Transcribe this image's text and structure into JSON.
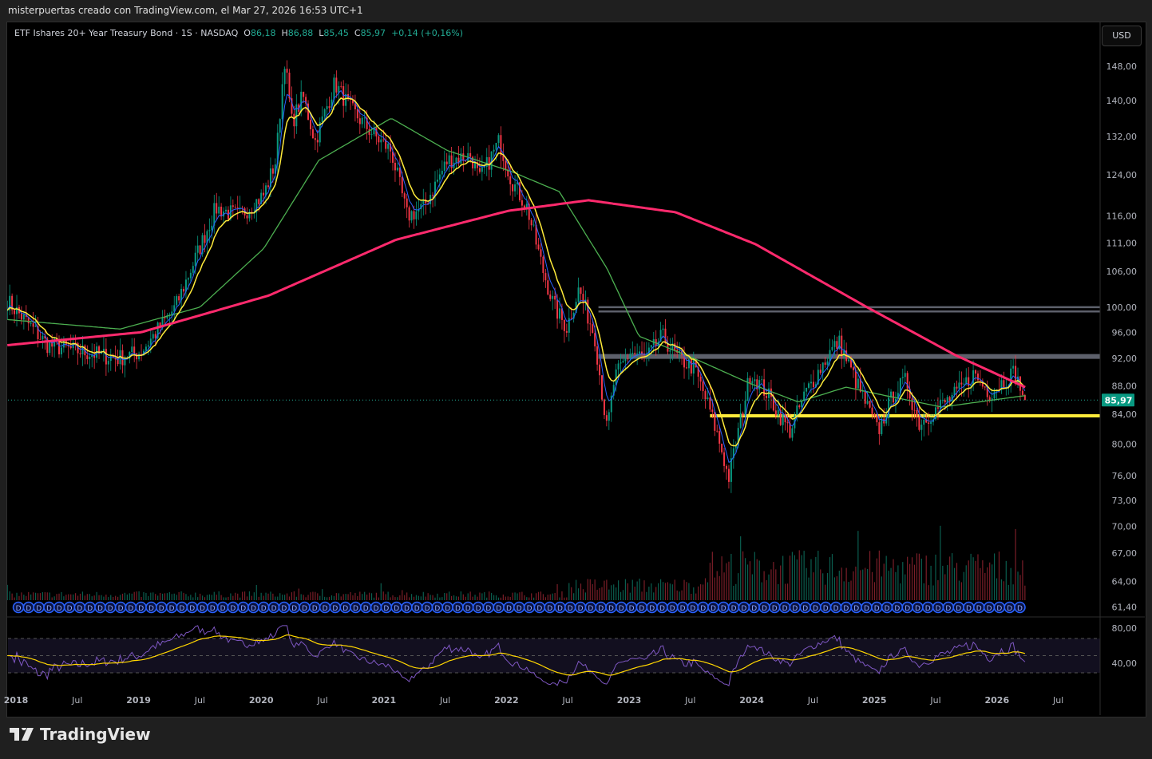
{
  "header": {
    "attribution": "misterpuertas creado con TradingView.com, el Mar 27, 2026 16:53 UTC+1"
  },
  "legend": {
    "symbol": "ETF Ishares 20+ Year Treasury Bond · 1S · NASDAQ",
    "o_label": "O",
    "o": "86,18",
    "h_label": "H",
    "h": "86,88",
    "l_label": "L",
    "l": "85,45",
    "c_label": "C",
    "c": "85,97",
    "change": "+0,14 (+0,16%)"
  },
  "currency_button": "USD",
  "brand": "TradingView",
  "colors": {
    "up": "#089981",
    "down": "#f23645",
    "ma200": "#ff2a6d",
    "ma50": "#4caf50",
    "ema_fast": "#ffeb3b",
    "ema_faster": "#2962ff",
    "rsi": "#7e57c2",
    "rsi_ma": "#ffd600",
    "level": "#5d606b",
    "support": "#ffeb3b"
  },
  "chart_data": {
    "type": "candlestick",
    "title": "ETF Ishares 20+ Year Treasury Bond · 1S · NASDAQ",
    "scale": "log",
    "ylim": [
      61.4,
      152
    ],
    "xlim": [
      2017.93,
      2026.6
    ],
    "y_ticks": [
      "148,00",
      "140,00",
      "132,00",
      "124,00",
      "116,00",
      "111,00",
      "106,00",
      "100,00",
      "96,00",
      "92,00",
      "88,00",
      "84,00",
      "80,00",
      "76,00",
      "73,00",
      "70,00",
      "67,00",
      "64,00",
      "61,40"
    ],
    "y_tick_values": [
      148,
      140,
      132,
      124,
      116,
      111,
      106,
      100,
      96,
      92,
      88,
      84,
      80,
      76,
      73,
      70,
      67,
      64,
      61.4
    ],
    "last_price": {
      "label": "85,97",
      "value": 85.97
    },
    "x_ticks": [
      {
        "t": 2018,
        "label": "2018"
      },
      {
        "t": 2018.5,
        "label": "Jul"
      },
      {
        "t": 2019,
        "label": "2019"
      },
      {
        "t": 2019.5,
        "label": "Jul"
      },
      {
        "t": 2020,
        "label": "2020"
      },
      {
        "t": 2020.5,
        "label": "Jul"
      },
      {
        "t": 2021,
        "label": "2021"
      },
      {
        "t": 2021.5,
        "label": "Jul"
      },
      {
        "t": 2022,
        "label": "2022"
      },
      {
        "t": 2022.5,
        "label": "Jul"
      },
      {
        "t": 2023,
        "label": "2023"
      },
      {
        "t": 2023.5,
        "label": "Jul"
      },
      {
        "t": 2024,
        "label": "2024"
      },
      {
        "t": 2024.5,
        "label": "Jul"
      },
      {
        "t": 2025,
        "label": "2025"
      },
      {
        "t": 2025.5,
        "label": "Jul"
      },
      {
        "t": 2026,
        "label": "2026"
      },
      {
        "t": 2026.5,
        "label": "Jul"
      }
    ],
    "price_path": [
      [
        2017.93,
        101
      ],
      [
        2018.26,
        94
      ],
      [
        2018.83,
        92
      ],
      [
        2019.02,
        93
      ],
      [
        2019.3,
        100
      ],
      [
        2019.63,
        117.5
      ],
      [
        2019.82,
        116
      ],
      [
        2020.02,
        120
      ],
      [
        2020.12,
        127
      ],
      [
        2020.19,
        150
      ],
      [
        2020.25,
        135
      ],
      [
        2020.34,
        141
      ],
      [
        2020.44,
        131
      ],
      [
        2020.6,
        144
      ],
      [
        2020.73,
        138
      ],
      [
        2020.93,
        132
      ],
      [
        2021.06,
        129
      ],
      [
        2021.19,
        116
      ],
      [
        2021.32,
        117.5
      ],
      [
        2021.52,
        127
      ],
      [
        2021.71,
        128
      ],
      [
        2021.78,
        123
      ],
      [
        2021.94,
        131
      ],
      [
        2022.04,
        123
      ],
      [
        2022.17,
        117.5
      ],
      [
        2022.3,
        106
      ],
      [
        2022.39,
        100
      ],
      [
        2022.49,
        96.7
      ],
      [
        2022.59,
        103
      ],
      [
        2022.72,
        95.4
      ],
      [
        2022.82,
        81.7
      ],
      [
        2022.88,
        89
      ],
      [
        2023.01,
        93
      ],
      [
        2023.14,
        92
      ],
      [
        2023.27,
        95.4
      ],
      [
        2023.4,
        92
      ],
      [
        2023.53,
        90.6
      ],
      [
        2023.66,
        84.5
      ],
      [
        2023.76,
        79
      ],
      [
        2023.81,
        75.6
      ],
      [
        2023.89,
        81.7
      ],
      [
        2023.99,
        90
      ],
      [
        2024.12,
        87
      ],
      [
        2024.31,
        81.7
      ],
      [
        2024.44,
        87
      ],
      [
        2024.64,
        93
      ],
      [
        2024.71,
        94.5
      ],
      [
        2024.84,
        89
      ],
      [
        2025.03,
        81.7
      ],
      [
        2025.16,
        87
      ],
      [
        2025.26,
        88.8
      ],
      [
        2025.36,
        82.7
      ],
      [
        2025.49,
        84.5
      ],
      [
        2025.68,
        87
      ],
      [
        2025.81,
        89.7
      ],
      [
        2025.94,
        87
      ],
      [
        2026.14,
        90
      ],
      [
        2026.23,
        86
      ]
    ],
    "ma200_path": [
      [
        2017.93,
        94
      ],
      [
        2019.02,
        96
      ],
      [
        2020.06,
        101.9
      ],
      [
        2021.1,
        111.6
      ],
      [
        2022.02,
        117
      ],
      [
        2022.67,
        119
      ],
      [
        2023.38,
        116.7
      ],
      [
        2024.03,
        110.8
      ],
      [
        2024.94,
        100
      ],
      [
        2025.66,
        92.5
      ],
      [
        2026.23,
        87.8
      ]
    ],
    "ma50_path": [
      [
        2017.93,
        98
      ],
      [
        2018.85,
        96.5
      ],
      [
        2019.5,
        100
      ],
      [
        2020.02,
        110
      ],
      [
        2020.47,
        127
      ],
      [
        2021.06,
        136
      ],
      [
        2021.52,
        129
      ],
      [
        2022.04,
        124.7
      ],
      [
        2022.43,
        120.7
      ],
      [
        2022.82,
        106.5
      ],
      [
        2023.08,
        95.4
      ],
      [
        2023.53,
        92
      ],
      [
        2023.99,
        88.3
      ],
      [
        2024.38,
        85.7
      ],
      [
        2024.77,
        87.8
      ],
      [
        2025.09,
        86.6
      ],
      [
        2025.55,
        85
      ],
      [
        2026.23,
        86.6
      ]
    ],
    "levels": [
      {
        "value": 100,
        "from": 2022.75,
        "kind": "resistance"
      },
      {
        "value": 99.3,
        "from": 2022.75,
        "kind": "resistance"
      },
      {
        "value": 92.3,
        "from": 2022.75,
        "kind": "resistance"
      },
      {
        "value": 83.8,
        "from": 2023.66,
        "kind": "support"
      }
    ],
    "rsi": {
      "ticks": [
        "80,00",
        "40,00"
      ],
      "tick_values": [
        80,
        40
      ],
      "band": [
        30,
        70
      ]
    }
  }
}
